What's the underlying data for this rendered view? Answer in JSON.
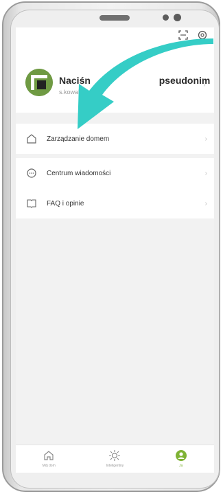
{
  "profile": {
    "name_visible_start": "Naciśn",
    "name_visible_end": "pseudonim",
    "email_visible": "s.kowalsk"
  },
  "menu": {
    "home_management": "Zarządzanie domem",
    "message_center": "Centrum wiadomości",
    "faq": "FAQ i opinie"
  },
  "tabs": {
    "my_home": "Mój dom",
    "smart": "Inteligentny",
    "me": "Ja"
  },
  "colors": {
    "accent_green": "#7fb335",
    "arrow_teal": "#35cdc6"
  },
  "icons": [
    "scan-icon",
    "settings-icon",
    "home-icon",
    "message-icon",
    "faq-icon",
    "chevron-right-icon",
    "sun-icon",
    "user-icon"
  ]
}
